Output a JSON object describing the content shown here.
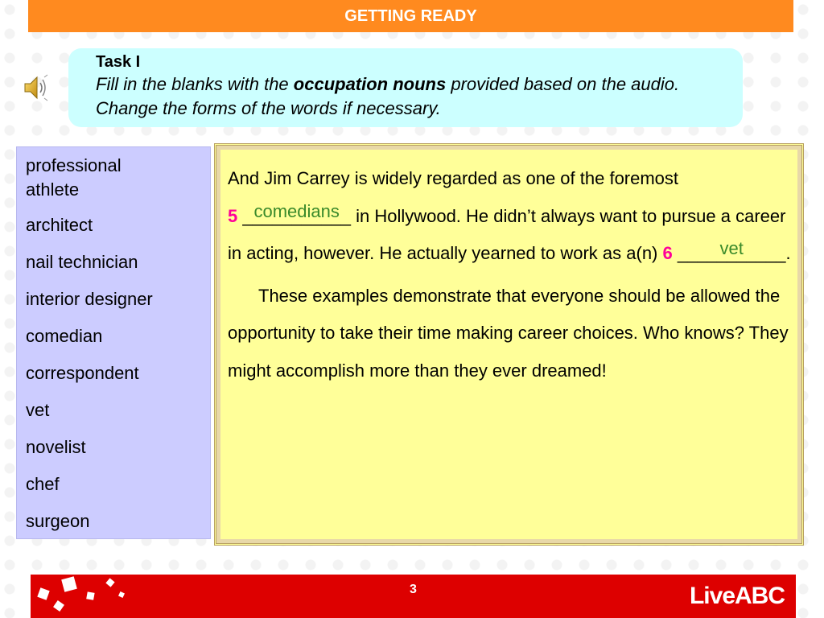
{
  "header": {
    "title": "GETTING READY"
  },
  "task": {
    "title": "Task I",
    "instr_part1": "Fill in the blanks with the ",
    "instr_bold": "occupation nouns",
    "instr_part2": " provided based on the audio. Change the forms of the words if necessary."
  },
  "word_bank": [
    "professional athlete",
    "architect",
    "nail technician",
    "interior designer",
    "comedian",
    "correspondent",
    "vet",
    "novelist",
    "chef",
    "surgeon"
  ],
  "passage": {
    "p1_a": "And Jim Carrey is widely regarded as one of the foremost",
    "num5": "5",
    "blank5_line": "___________",
    "answer5": "comedians",
    "p1_b": " in Hollywood. He didn’t always want to pursue a career in acting, however. He actually yearned to work as a(n) ",
    "num6": "6",
    "blank6_line": "___________",
    "answer6": "vet",
    "p1_c": ".",
    "p2": "These examples demonstrate that everyone should be allowed the opportunity to take their time making career choices. Who knows? They might accomplish more than they ever dreamed!"
  },
  "footer": {
    "page_number": "3",
    "logo_text": "LiveABC"
  },
  "icons": {
    "speaker": "speaker-icon"
  },
  "colors": {
    "header": "#ff8a1f",
    "task_bg": "#ccffff",
    "word_bank_bg": "#ccccff",
    "passage_bg": "#ffff99",
    "number": "#ff0099",
    "answer": "#3a8a2a",
    "footer": "#dd0000"
  }
}
